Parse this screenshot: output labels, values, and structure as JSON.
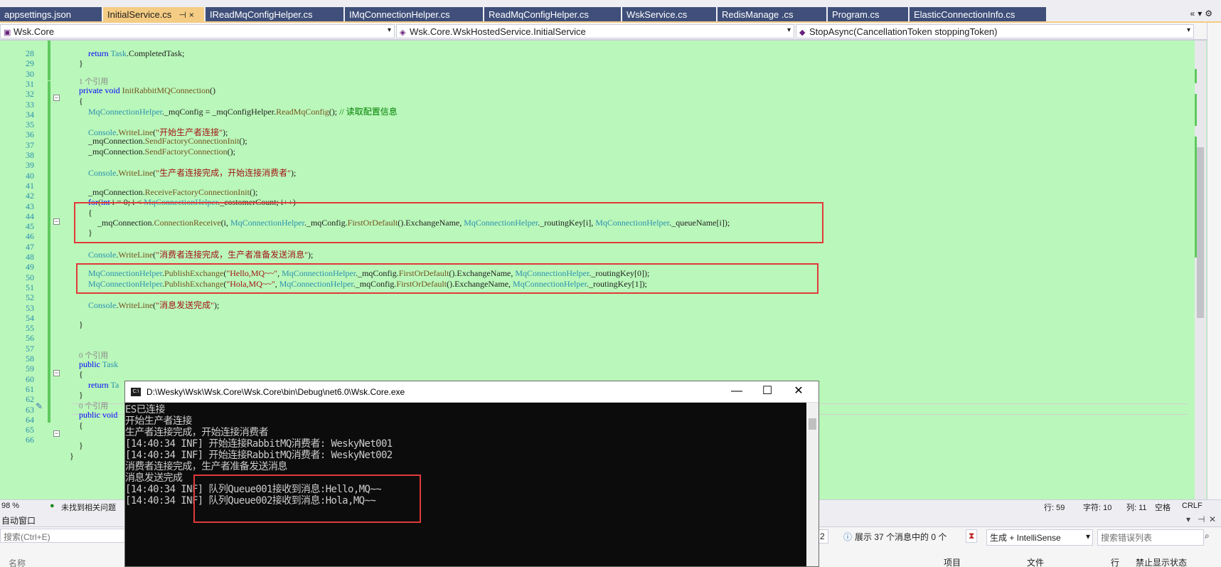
{
  "tabs": [
    {
      "label": "appsettings.json",
      "active": false
    },
    {
      "label": "InitialService.cs",
      "active": true
    },
    {
      "label": "IReadMqConfigHelper.cs",
      "active": false
    },
    {
      "label": "IMqConnectionHelper.cs",
      "active": false
    },
    {
      "label": "ReadMqConfigHelper.cs",
      "active": false
    },
    {
      "label": "WskService.cs",
      "active": false
    },
    {
      "label": "RedisManage .cs",
      "active": false
    },
    {
      "label": "Program.cs",
      "active": false
    },
    {
      "label": "ElasticConnectionInfo.cs",
      "active": false
    }
  ],
  "tab_pin_glyph": "⊣",
  "tab_close_glyph": "×",
  "navbar": {
    "project": "Wsk.Core",
    "class": "Wsk.Core.WskHostedService.InitialService",
    "member": "StopAsync(CancellationToken stoppingToken)"
  },
  "references": {
    "r31": "1 个引用",
    "r57": "0 个引用",
    "r61": "0 个引用"
  },
  "code": {
    "l28": {
      "kw": "return",
      "ty": "Task",
      "rest": ".CompletedTask;"
    },
    "l30": "}",
    "l32": {
      "kw1": "private",
      "kw2": "void",
      "mt": "InitRabbitMQConnection",
      "rest": "()"
    },
    "l33": "{",
    "l34": {
      "ty": "MqConnectionHelper",
      "a": "._mqConfig = _mqConfigHelper.",
      "mt": "ReadMqConfig",
      "b": "(); ",
      "cm": "// 读取配置信息"
    },
    "l36": {
      "ty": "Console",
      "dot": ".",
      "mt": "WriteLine",
      "open": "(",
      "st": "\"开始生产者连接\"",
      "close": ");"
    },
    "l37": {
      "a": "_mqConnection.",
      "mt": "SendFactoryConnectionInit",
      "b": "();"
    },
    "l38": {
      "a": "_mqConnection.",
      "mt": "SendFactoryConnection",
      "b": "();"
    },
    "l40": {
      "ty": "Console",
      "dot": ".",
      "mt": "WriteLine",
      "open": "(",
      "st": "\"生产者连接完成，开始连接消费者\"",
      "close": ");"
    },
    "l42": {
      "a": "_mqConnection.",
      "mt": "ReceiveFactoryConnectionInit",
      "b": "();"
    },
    "l43": {
      "kw1": "for",
      "a": "(",
      "kw2": "int",
      "b": " i = 0; i < ",
      "ty": "MqConnectionHelper",
      "c": "._costomerCount; i++)"
    },
    "l44": "{",
    "l45": {
      "a": "_mqConnection.",
      "mt": "ConnectionReceive",
      "b": "(i, ",
      "ty1": "MqConnectionHelper",
      "c": "._mqConfig.",
      "mt2": "FirstOrDefault",
      "d": "().ExchangeName, ",
      "ty2": "MqConnectionHelper",
      "e": "._routingKey[i], ",
      "ty3": "MqConnectionHelper",
      "f": "._queueName[i]);"
    },
    "l46": "}",
    "l48": {
      "ty": "Console",
      "dot": ".",
      "mt": "WriteLine",
      "open": "(",
      "st": "\"消费者连接完成，生产者准备发送消息\"",
      "close": ");"
    },
    "l50": {
      "ty": "MqConnectionHelper",
      "dot": ".",
      "mt": "PublishExchange",
      "open": "(",
      "st": "\"Hello,MQ~~\"",
      "a": ", ",
      "ty2": "MqConnectionHelper",
      "b": "._mqConfig.",
      "mt2": "FirstOrDefault",
      "c": "().ExchangeName, ",
      "ty3": "MqConnectionHelper",
      "d": "._routingKey[0]);"
    },
    "l51": {
      "ty": "MqConnectionHelper",
      "dot": ".",
      "mt": "PublishExchange",
      "open": "(",
      "st": "\"Hola,MQ~~\"",
      "a": ", ",
      "ty2": "MqConnectionHelper",
      "b": "._mqConfig.",
      "mt2": "FirstOrDefault",
      "c": "().ExchangeName, ",
      "ty3": "MqConnectionHelper",
      "d": "._routingKey[1]);"
    },
    "l53": {
      "ty": "Console",
      "dot": ".",
      "mt": "WriteLine",
      "open": "(",
      "st": "\"消息发送完成\"",
      "close": ");"
    },
    "l55": "}",
    "l58": {
      "kw": "public",
      "ty": "Task"
    },
    "l59": "{",
    "l60": {
      "kw": "return",
      "ty": "Ta"
    },
    "l61": "}",
    "l62": {
      "kw1": "public",
      "kw2": "void"
    },
    "l63": "{",
    "l65": "}",
    "l66": "}"
  },
  "line_numbers": [
    "28",
    "29",
    "30",
    "31",
    "32",
    "33",
    "34",
    "35",
    "36",
    "37",
    "38",
    "39",
    "40",
    "41",
    "42",
    "43",
    "44",
    "45",
    "46",
    "47",
    "48",
    "49",
    "50",
    "51",
    "52",
    "53",
    "54",
    "55",
    "56",
    "57",
    "58",
    "59",
    "60",
    "61",
    "62",
    "63",
    "64",
    "65",
    "66"
  ],
  "console": {
    "title": "D:\\Wesky\\Wsk\\Wsk.Core\\Wsk.Core\\bin\\Debug\\net6.0\\Wsk.Core.exe",
    "icon_text": "C:\\",
    "minimize": "—",
    "maximize": "☐",
    "close": "✕",
    "lines": [
      "ES已连接",
      "开始生产者连接",
      "生产者连接完成，开始连接消费者",
      "[14:40:34 INF] 开始连接RabbitMQ消费者: WeskyNet001",
      "[14:40:34 INF] 开始连接RabbitMQ消费者: WeskyNet002",
      "消费者连接完成，生产者准备发送消息",
      "消息发送完成",
      "[14:40:34 INF] 队列Queue001接收到消息:Hello,MQ~~",
      "[14:40:34 INF] 队列Queue002接收到消息:Hola,MQ~~"
    ]
  },
  "status": {
    "zoom": "98 %",
    "issues": "未找到相关问题",
    "line": "行: 59",
    "char": "字符: 10",
    "col": "列: 11",
    "spacing": "空格",
    "eol": "CRLF"
  },
  "autos": {
    "title": "自动窗口",
    "search_placeholder": "搜索(Ctrl+E)",
    "col_name": "名称",
    "errors_count": "2",
    "messages": "展示 37 个消息中的 0 个",
    "build_filter": "生成 + IntelliSense",
    "search_errors": "搜索错误列表",
    "col_project": "项目",
    "col_file": "文件",
    "col_line": "行",
    "col_suppress": "禁止显示状态"
  },
  "colors": {
    "editor_bg": "#baf7ba",
    "tab_active": "#f5cc84",
    "tab_inactive": "#3f4f7a",
    "highlight": "#e03a3a"
  }
}
